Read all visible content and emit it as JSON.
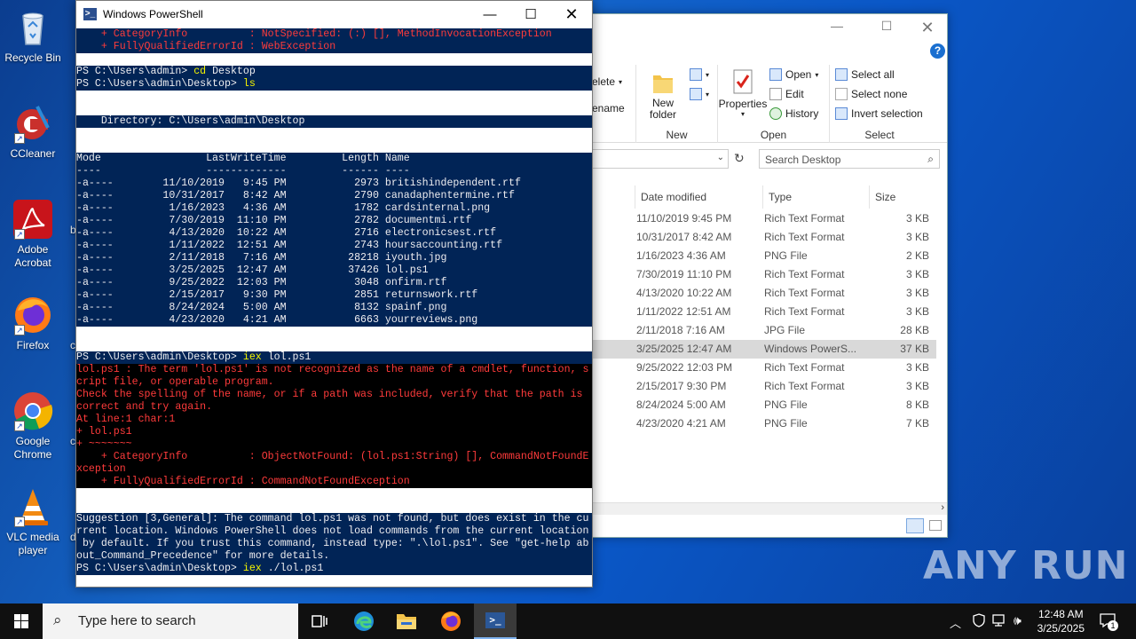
{
  "desktop": {
    "icons": [
      {
        "label": "Recycle Bin"
      },
      {
        "label": "CCleaner"
      },
      {
        "label": "Adobe Acrobat"
      },
      {
        "label": "Firefox"
      },
      {
        "label": "Google Chrome"
      },
      {
        "label": "VLC media player"
      }
    ],
    "cut_labels": [
      "b",
      "c",
      "c",
      "d"
    ],
    "watermark": "ANY RUN"
  },
  "explorer": {
    "ribbon": {
      "delete_label": "elete",
      "rename_label": "ename",
      "new_folder_label": "New folder",
      "group_new": "New",
      "properties_label": "Properties",
      "open_label": "Open",
      "edit_label": "Edit",
      "history_label": "History",
      "group_open": "Open",
      "select_all_label": "Select all",
      "select_none_label": "Select none",
      "invert_selection_label": "Invert selection",
      "group_select": "Select"
    },
    "search_placeholder": "Search Desktop",
    "columns": [
      "Date modified",
      "Type",
      "Size"
    ],
    "files": [
      {
        "date": "11/10/2019 9:45 PM",
        "type": "Rich Text Format",
        "size": "3 KB"
      },
      {
        "date": "10/31/2017 8:42 AM",
        "type": "Rich Text Format",
        "size": "3 KB"
      },
      {
        "date": "1/16/2023 4:36 AM",
        "type": "PNG File",
        "size": "2 KB"
      },
      {
        "date": "7/30/2019 11:10 PM",
        "type": "Rich Text Format",
        "size": "3 KB"
      },
      {
        "date": "4/13/2020 10:22 AM",
        "type": "Rich Text Format",
        "size": "3 KB"
      },
      {
        "date": "1/11/2022 12:51 AM",
        "type": "Rich Text Format",
        "size": "3 KB"
      },
      {
        "date": "2/11/2018 7:16 AM",
        "type": "JPG File",
        "size": "28 KB"
      },
      {
        "date": "3/25/2025 12:47 AM",
        "type": "Windows PowerS...",
        "size": "37 KB"
      },
      {
        "date": "9/25/2022 12:03 PM",
        "type": "Rich Text Format",
        "size": "3 KB"
      },
      {
        "date": "2/15/2017 9:30 PM",
        "type": "Rich Text Format",
        "size": "3 KB"
      },
      {
        "date": "8/24/2024 5:00 AM",
        "type": "PNG File",
        "size": "8 KB"
      },
      {
        "date": "4/23/2020 4:21 AM",
        "type": "PNG File",
        "size": "7 KB"
      }
    ]
  },
  "powershell": {
    "title": "Windows PowerShell",
    "lines": [
      {
        "bg": "b",
        "cls": "red",
        "text": "    + CategoryInfo          : NotSpecified: (:) [], MethodInvocationException"
      },
      {
        "bg": "b",
        "cls": "red",
        "text": "    + FullyQualifiedErrorId : WebException"
      },
      {
        "bg": "w",
        "cls": "",
        "text": " "
      },
      {
        "bg": "b",
        "cls": "",
        "text": "PS C:\\Users\\admin> cd Desktop"
      },
      {
        "bg": "b",
        "cls": "",
        "text": "PS C:\\Users\\admin\\Desktop> ls"
      },
      {
        "bg": "w",
        "cls": "",
        "text": " "
      },
      {
        "bg": "w",
        "cls": "",
        "text": " "
      },
      {
        "bg": "b",
        "cls": "",
        "text": "    Directory: C:\\Users\\admin\\Desktop"
      },
      {
        "bg": "w",
        "cls": "",
        "text": " "
      },
      {
        "bg": "w",
        "cls": "",
        "text": " "
      },
      {
        "bg": "b",
        "cls": "",
        "text": "Mode                 LastWriteTime         Length Name"
      },
      {
        "bg": "b",
        "cls": "",
        "text": "----                 -------------         ------ ----"
      },
      {
        "bg": "b",
        "cls": "",
        "text": "-a----        11/10/2019   9:45 PM           2973 britishindependent.rtf"
      },
      {
        "bg": "b",
        "cls": "",
        "text": "-a----        10/31/2017   8:42 AM           2790 canadaphentermine.rtf"
      },
      {
        "bg": "b",
        "cls": "",
        "text": "-a----         1/16/2023   4:36 AM           1782 cardsinternal.png"
      },
      {
        "bg": "b",
        "cls": "",
        "text": "-a----         7/30/2019  11:10 PM           2782 documentmi.rtf"
      },
      {
        "bg": "b",
        "cls": "",
        "text": "-a----         4/13/2020  10:22 AM           2716 electronicsest.rtf"
      },
      {
        "bg": "b",
        "cls": "",
        "text": "-a----         1/11/2022  12:51 AM           2743 hoursaccounting.rtf"
      },
      {
        "bg": "b",
        "cls": "",
        "text": "-a----         2/11/2018   7:16 AM          28218 iyouth.jpg"
      },
      {
        "bg": "b",
        "cls": "",
        "text": "-a----         3/25/2025  12:47 AM          37426 lol.ps1"
      },
      {
        "bg": "b",
        "cls": "",
        "text": "-a----         9/25/2022  12:03 PM           3048 onfirm.rtf"
      },
      {
        "bg": "b",
        "cls": "",
        "text": "-a----         2/15/2017   9:30 PM           2851 returnswork.rtf"
      },
      {
        "bg": "b",
        "cls": "",
        "text": "-a----         8/24/2024   5:00 AM           8132 spainf.png"
      },
      {
        "bg": "b",
        "cls": "",
        "text": "-a----         4/23/2020   4:21 AM           6663 yourreviews.png"
      },
      {
        "bg": "w",
        "cls": "",
        "text": " "
      },
      {
        "bg": "w",
        "cls": "",
        "text": " "
      },
      {
        "bg": "b",
        "cls": "",
        "text": "PS C:\\Users\\admin\\Desktop> iex lol.ps1"
      },
      {
        "bg": "k",
        "cls": "red",
        "text": "lol.ps1 : The term 'lol.ps1' is not recognized as the name of a cmdlet, function, s"
      },
      {
        "bg": "k",
        "cls": "red",
        "text": "cript file, or operable program."
      },
      {
        "bg": "k",
        "cls": "red",
        "text": "Check the spelling of the name, or if a path was included, verify that the path is"
      },
      {
        "bg": "k",
        "cls": "red",
        "text": "correct and try again."
      },
      {
        "bg": "k",
        "cls": "red",
        "text": "At line:1 char:1"
      },
      {
        "bg": "k",
        "cls": "red",
        "text": "+ lol.ps1"
      },
      {
        "bg": "k",
        "cls": "red",
        "text": "+ ~~~~~~~"
      },
      {
        "bg": "k",
        "cls": "red",
        "text": "    + CategoryInfo          : ObjectNotFound: (lol.ps1:String) [], CommandNotFoundE"
      },
      {
        "bg": "k",
        "cls": "red",
        "text": "xception"
      },
      {
        "bg": "k",
        "cls": "red",
        "text": "    + FullyQualifiedErrorId : CommandNotFoundException"
      },
      {
        "bg": "w",
        "cls": "",
        "text": " "
      },
      {
        "bg": "w",
        "cls": "",
        "text": " "
      },
      {
        "bg": "b",
        "cls": "",
        "text": "Suggestion [3,General]: The command lol.ps1 was not found, but does exist in the cu"
      },
      {
        "bg": "b",
        "cls": "",
        "text": "rrent location. Windows PowerShell does not load commands from the current location"
      },
      {
        "bg": "b",
        "cls": "",
        "text": " by default. If you trust this command, instead type: \".\\lol.ps1\". See \"get-help ab"
      },
      {
        "bg": "b",
        "cls": "",
        "text": "out_Command_Precedence\" for more details."
      },
      {
        "bg": "b",
        "cls": "",
        "text": "PS C:\\Users\\admin\\Desktop> iex ./lol.ps1"
      }
    ]
  },
  "taskbar": {
    "search_placeholder": "Type here to search",
    "time": "12:48 AM",
    "date": "3/25/2025",
    "notification_count": "1"
  }
}
